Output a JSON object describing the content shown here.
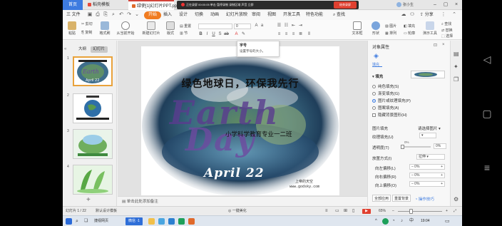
{
  "tabs": [
    {
      "label": "首页"
    },
    {
      "label": "稻壳模板"
    },
    {
      "label": "绿使[1]幻灯片PPT.ppt"
    }
  ],
  "recording_bar": {
    "text": "正在录屏  00:00:05  单击·暂停录制  录制区域  声音  立即",
    "stop_label": "结束录屏"
  },
  "user": {
    "name": "张小生"
  },
  "menu": {
    "file": "三 文件",
    "items": [
      "开始",
      "插入",
      "设计",
      "切换",
      "动画",
      "幻灯片放映",
      "审阅",
      "视图",
      "开发工具",
      "特色功能"
    ],
    "active": "开始",
    "search": "查找",
    "share": "分享"
  },
  "ribbon": {
    "paste": "粘贴",
    "cut": "剪切",
    "copy": "复制",
    "format_painter": "格式刷",
    "play_from_current": "从当前开始",
    "new_slide": "新建幻灯片",
    "layout": "版式",
    "section": "节",
    "reset": "重置",
    "font_size": "0",
    "textbox": "文本框",
    "shape": "形状",
    "arrange": "排列",
    "outline": "轮廓",
    "presentation_tool": "演示工具",
    "replace": "替换",
    "select": "选择",
    "font_name": ""
  },
  "tooltip": {
    "title": "字号",
    "body": "设置字号的大小。"
  },
  "left_panel": {
    "tab_outline": "大纲",
    "tab_slides": "幻灯片",
    "slides": [
      {
        "num": "1",
        "caption": "绿色地球日"
      },
      {
        "num": "2",
        "caption": "地球简介"
      },
      {
        "num": "3",
        "caption": ""
      },
      {
        "num": "4",
        "caption": ""
      }
    ]
  },
  "slide": {
    "title": "绿色地球日，环保我先行",
    "logo_line1": "Earth",
    "logo_line2": "Day",
    "subtitle": "小学科学教育专业一二班",
    "date": "April 22",
    "site_line1": "上帝的天空",
    "site_line2": "www.godsky.com"
  },
  "notes": "单击此处添加备注",
  "right_panel": {
    "title": "对象属性",
    "tab": "填充",
    "section": "填充",
    "options": [
      {
        "label": "纯色填充(S)",
        "on": false
      },
      {
        "label": "渐变填充(G)",
        "on": false
      },
      {
        "label": "图片或纹理填充(P)",
        "on": true
      },
      {
        "label": "图案填充(A)",
        "on": false
      },
      {
        "label": "隐藏背景图形(H)",
        "on": false
      }
    ],
    "image_fill_label": "图片填充",
    "image_fill_value": "请选择图片",
    "texture_label": "纹理填充(U)",
    "transparency_label": "透明度(T)",
    "transparency_value": "0%",
    "placement_label": "放置方式(I)",
    "placement_value": "拉伸",
    "offsets": [
      {
        "label": "向左偏移(L)",
        "value": "0%"
      },
      {
        "label": "向右偏移(R)",
        "value": "0%"
      },
      {
        "label": "向上偏移(O)",
        "value": "0%"
      }
    ],
    "apply_all": "全部应用",
    "reset_bg": "重置背景",
    "tips": "操作技巧"
  },
  "status": {
    "slide_count": "幻灯片 1 / 22",
    "theme": "默认设计模板",
    "beautify": "一键美化",
    "zoom": "65%"
  },
  "taskbar": {
    "search_label": "",
    "app_label": "微信 ·1",
    "app2_label": "捷视网页",
    "time": "19:04"
  },
  "colors": {
    "accent": "#3d7be0",
    "active_tab": "#f07b1f",
    "record_red": "#e04030"
  }
}
